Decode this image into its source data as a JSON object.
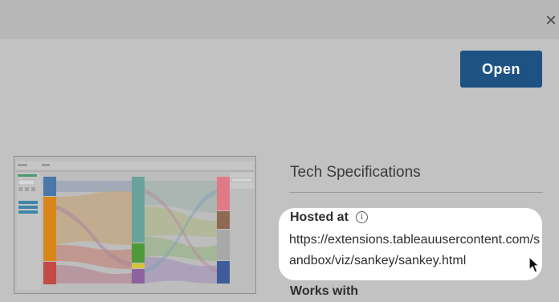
{
  "dialog": {
    "close_icon": "×",
    "open_label": "Open"
  },
  "specs": {
    "title": "Tech Specifications",
    "hosted_at_label": "Hosted at",
    "info_icon": "i",
    "hosted_url": "https://extensions.tableauusercontent.com/sandbox/viz/sankey/sankey.html",
    "works_with_label": "Works with"
  },
  "icons": {
    "close": "close-icon",
    "info": "info-icon",
    "cursor": "mouse-pointer-icon"
  },
  "colors": {
    "open_button": "#1d5283",
    "overlay": "#c2c2c2",
    "card": "#ffffff"
  }
}
